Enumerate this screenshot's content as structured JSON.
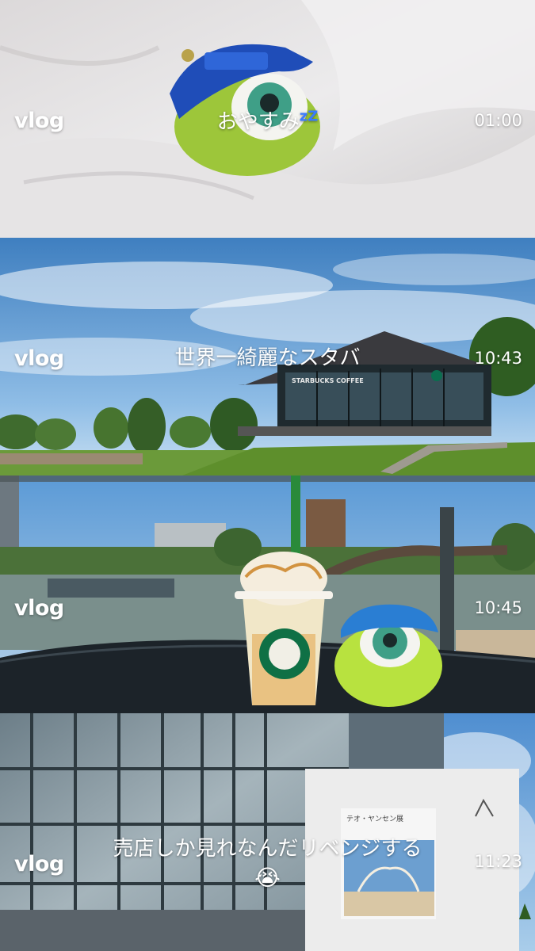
{
  "panels": [
    {
      "label": "vlog",
      "caption": "おやすみ",
      "caption_suffix": "zZ",
      "time": "01:00"
    },
    {
      "label": "vlog",
      "caption": "世界一綺麗なスタバ",
      "time": "10:43",
      "sign": "STARBUCKS COFFEE"
    },
    {
      "label": "vlog",
      "caption": "",
      "time": "10:45"
    },
    {
      "label": "vlog",
      "caption": "売店しか見れなんだリベンジする",
      "caption_emoji": "😭",
      "time": "11:23",
      "poster_title": "テオ・ヤンセン展"
    }
  ]
}
